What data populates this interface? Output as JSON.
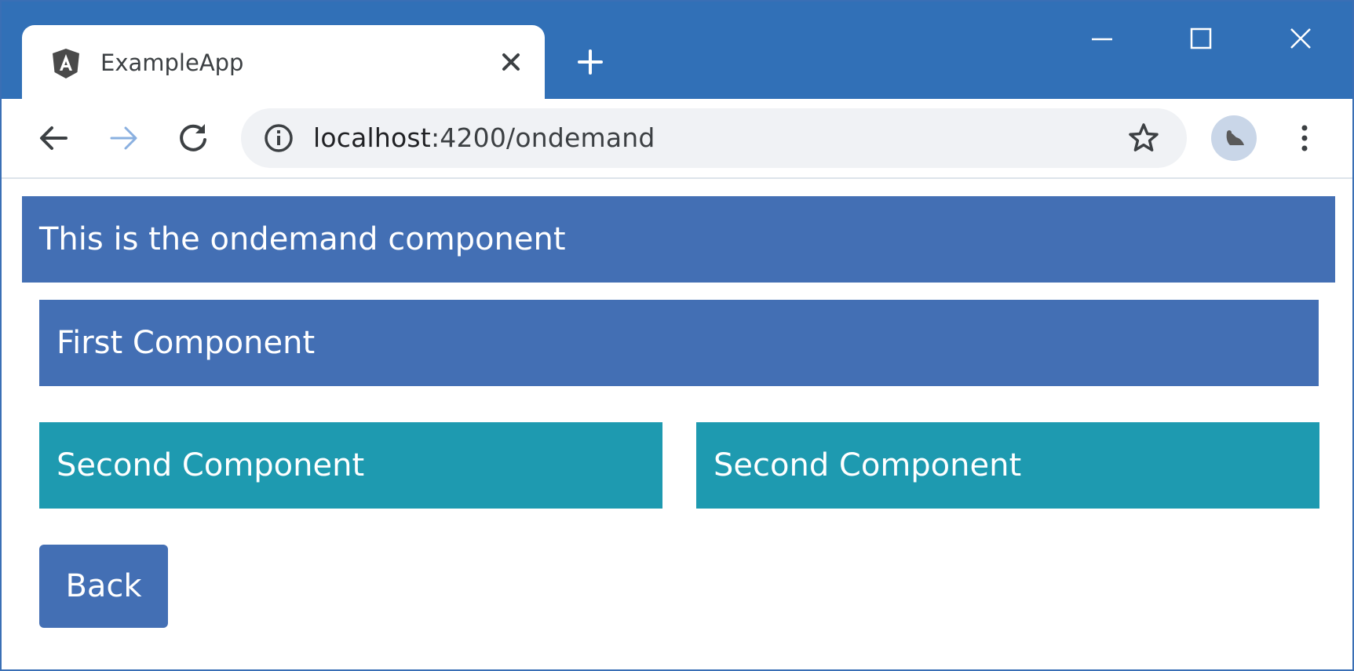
{
  "browser": {
    "tab": {
      "title": "ExampleApp",
      "favicon": "angular-icon",
      "close_icon": "close-icon"
    },
    "new_tab_icon": "plus-icon",
    "window_controls": [
      "minimize-icon",
      "maximize-icon",
      "close-icon"
    ],
    "nav": {
      "back_icon": "arrow-left-icon",
      "forward_icon": "arrow-right-icon",
      "reload_icon": "reload-icon"
    },
    "address_bar": {
      "host": "localhost",
      "path": ":4200/ondemand",
      "info_icon": "info-icon",
      "bookmark_icon": "star-icon"
    },
    "profile_icon": "profile-avatar-icon",
    "menu_icon": "more-vert-icon",
    "colors": {
      "titlebar": "#3170b7",
      "omnibox": "#f0f2f5"
    }
  },
  "page": {
    "header": {
      "text": "This is the ondemand component"
    },
    "first_component": {
      "text": "First Component"
    },
    "second_components": [
      {
        "text": "Second Component"
      },
      {
        "text": "Second Component"
      }
    ],
    "back_button": {
      "label": "Back"
    },
    "colors": {
      "primary": "#436fb4",
      "info": "#1e9ab0",
      "text": "#ffffff"
    }
  }
}
